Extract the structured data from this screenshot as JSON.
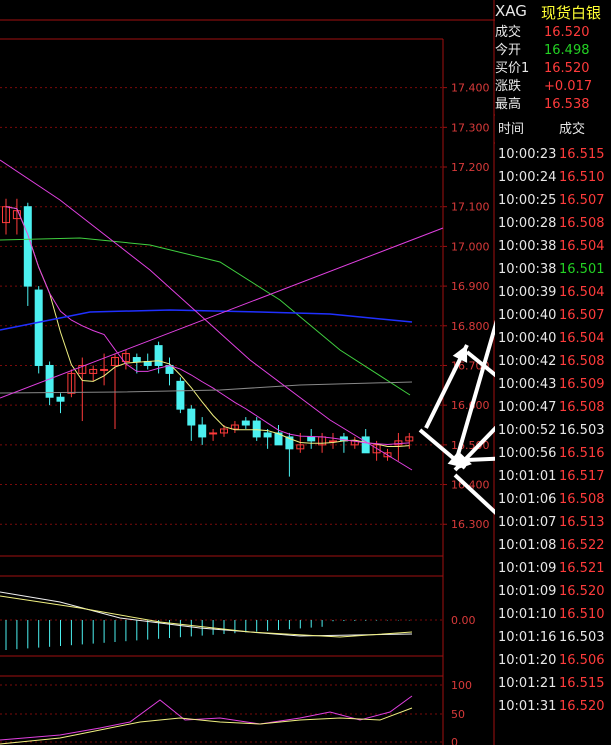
{
  "header": {
    "symbol": "XAG",
    "name": "现货白银"
  },
  "quote": [
    {
      "label": "成交",
      "value": "16.520",
      "color": "red"
    },
    {
      "label": "今开",
      "value": "16.498",
      "color": "green"
    },
    {
      "label": "买价1",
      "value": "16.520",
      "color": "red"
    },
    {
      "label": "涨跌",
      "value": "+0.017",
      "color": "red"
    },
    {
      "label": "最高",
      "value": "16.538",
      "color": "red"
    }
  ],
  "ticks_header": {
    "time": "时间",
    "price": "成交"
  },
  "ticks": [
    {
      "time": "10:00:23",
      "price": "16.515",
      "color": "red"
    },
    {
      "time": "10:00:24",
      "price": "16.510",
      "color": "red"
    },
    {
      "time": "10:00:25",
      "price": "16.507",
      "color": "red"
    },
    {
      "time": "10:00:28",
      "price": "16.508",
      "color": "red"
    },
    {
      "time": "10:00:38",
      "price": "16.504",
      "color": "red"
    },
    {
      "time": "10:00:38",
      "price": "16.501",
      "color": "green"
    },
    {
      "time": "10:00:39",
      "price": "16.504",
      "color": "red"
    },
    {
      "time": "10:00:40",
      "price": "16.507",
      "color": "red"
    },
    {
      "time": "10:00:40",
      "price": "16.504",
      "color": "red"
    },
    {
      "time": "10:00:42",
      "price": "16.508",
      "color": "red"
    },
    {
      "time": "10:00:43",
      "price": "16.509",
      "color": "red"
    },
    {
      "time": "10:00:47",
      "price": "16.508",
      "color": "red"
    },
    {
      "time": "10:00:52",
      "price": "16.503",
      "color": "white"
    },
    {
      "time": "10:00:56",
      "price": "16.516",
      "color": "red"
    },
    {
      "time": "10:01:01",
      "price": "16.517",
      "color": "red"
    },
    {
      "time": "10:01:06",
      "price": "16.508",
      "color": "red"
    },
    {
      "time": "10:01:07",
      "price": "16.513",
      "color": "red"
    },
    {
      "time": "10:01:08",
      "price": "16.522",
      "color": "red"
    },
    {
      "time": "10:01:09",
      "price": "16.521",
      "color": "red"
    },
    {
      "time": "10:01:09",
      "price": "16.520",
      "color": "red"
    },
    {
      "time": "10:01:10",
      "price": "16.510",
      "color": "red"
    },
    {
      "time": "10:01:16",
      "price": "16.503",
      "color": "white"
    },
    {
      "time": "10:01:20",
      "price": "16.506",
      "color": "red"
    },
    {
      "time": "10:01:21",
      "price": "16.515",
      "color": "red"
    },
    {
      "time": "10:01:31",
      "price": "16.520",
      "color": "red"
    }
  ],
  "colors": {
    "up": "#ff3b3b",
    "down": "#4cf0f0",
    "grid": "#7a0a0a",
    "axis_text": "#d83a3a"
  },
  "chart_data": {
    "type": "candlestick",
    "price_axis": {
      "ticks": [
        "17.400",
        "17.300",
        "17.200",
        "17.100",
        "17.000",
        "16.900",
        "16.800",
        "16.700",
        "16.600",
        "16.500",
        "16.400",
        "16.300"
      ],
      "ylim": [
        16.22,
        17.52
      ]
    },
    "candles": [
      {
        "o": 17.06,
        "h": 17.12,
        "l": 17.03,
        "c": 17.1
      },
      {
        "o": 17.07,
        "h": 17.12,
        "l": 17.03,
        "c": 17.09
      },
      {
        "o": 17.1,
        "h": 17.11,
        "l": 16.85,
        "c": 16.9
      },
      {
        "o": 16.89,
        "h": 16.9,
        "l": 16.68,
        "c": 16.7
      },
      {
        "o": 16.7,
        "h": 16.71,
        "l": 16.6,
        "c": 16.62
      },
      {
        "o": 16.62,
        "h": 16.63,
        "l": 16.58,
        "c": 16.61
      },
      {
        "o": 16.63,
        "h": 16.69,
        "l": 16.62,
        "c": 16.68
      },
      {
        "o": 16.68,
        "h": 16.72,
        "l": 16.56,
        "c": 16.7
      },
      {
        "o": 16.68,
        "h": 16.7,
        "l": 16.66,
        "c": 16.69
      },
      {
        "o": 16.69,
        "h": 16.73,
        "l": 16.65,
        "c": 16.69
      },
      {
        "o": 16.7,
        "h": 16.73,
        "l": 16.54,
        "c": 16.72
      },
      {
        "o": 16.71,
        "h": 16.74,
        "l": 16.69,
        "c": 16.73
      },
      {
        "o": 16.72,
        "h": 16.73,
        "l": 16.68,
        "c": 16.71
      },
      {
        "o": 16.71,
        "h": 16.73,
        "l": 16.69,
        "c": 16.7
      },
      {
        "o": 16.75,
        "h": 16.76,
        "l": 16.68,
        "c": 16.7
      },
      {
        "o": 16.7,
        "h": 16.72,
        "l": 16.65,
        "c": 16.68
      },
      {
        "o": 16.66,
        "h": 16.67,
        "l": 16.58,
        "c": 16.59
      },
      {
        "o": 16.59,
        "h": 16.6,
        "l": 16.51,
        "c": 16.55
      },
      {
        "o": 16.55,
        "h": 16.57,
        "l": 16.5,
        "c": 16.52
      },
      {
        "o": 16.53,
        "h": 16.54,
        "l": 16.51,
        "c": 16.53
      },
      {
        "o": 16.53,
        "h": 16.55,
        "l": 16.52,
        "c": 16.54
      },
      {
        "o": 16.54,
        "h": 16.56,
        "l": 16.53,
        "c": 16.55
      },
      {
        "o": 16.56,
        "h": 16.57,
        "l": 16.54,
        "c": 16.55
      },
      {
        "o": 16.56,
        "h": 16.57,
        "l": 16.51,
        "c": 16.52
      },
      {
        "o": 16.53,
        "h": 16.54,
        "l": 16.49,
        "c": 16.52
      },
      {
        "o": 16.53,
        "h": 16.55,
        "l": 16.51,
        "c": 16.5
      },
      {
        "o": 16.52,
        "h": 16.53,
        "l": 16.42,
        "c": 16.49
      },
      {
        "o": 16.49,
        "h": 16.53,
        "l": 16.48,
        "c": 16.5
      },
      {
        "o": 16.52,
        "h": 16.54,
        "l": 16.49,
        "c": 16.51
      },
      {
        "o": 16.5,
        "h": 16.53,
        "l": 16.48,
        "c": 16.52
      },
      {
        "o": 16.51,
        "h": 16.53,
        "l": 16.49,
        "c": 16.51
      },
      {
        "o": 16.52,
        "h": 16.53,
        "l": 16.48,
        "c": 16.51
      },
      {
        "o": 16.5,
        "h": 16.52,
        "l": 16.49,
        "c": 16.51
      },
      {
        "o": 16.52,
        "h": 16.54,
        "l": 16.48,
        "c": 16.48
      },
      {
        "o": 16.48,
        "h": 16.51,
        "l": 16.46,
        "c": 16.5
      },
      {
        "o": 16.47,
        "h": 16.49,
        "l": 16.46,
        "c": 16.48
      },
      {
        "o": 16.5,
        "h": 16.53,
        "l": 16.46,
        "c": 16.51
      },
      {
        "o": 16.51,
        "h": 16.53,
        "l": 16.49,
        "c": 16.52
      }
    ],
    "macd_axis": {
      "ticks": [
        "0.00"
      ]
    },
    "rsi_axis": {
      "ticks": [
        "100",
        "50",
        "0"
      ]
    }
  }
}
